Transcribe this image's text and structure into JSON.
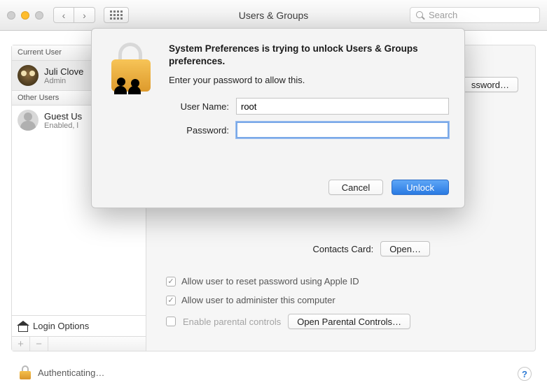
{
  "toolbar": {
    "title": "Users & Groups",
    "search_placeholder": "Search"
  },
  "sidebar": {
    "current_header": "Current User",
    "other_header": "Other Users",
    "current_user": {
      "name": "Juli Clove",
      "role": "Admin"
    },
    "guest_user": {
      "name": "Guest Us",
      "role": "Enabled, l"
    },
    "login_options": "Login Options"
  },
  "detail": {
    "change_password": "ssword…",
    "contacts_label": "Contacts Card:",
    "open_btn": "Open…",
    "checks": {
      "reset_apple_id": "Allow user to reset password using Apple ID",
      "administer": "Allow user to administer this computer",
      "parental_label": "Enable parental controls",
      "parental_btn": "Open Parental Controls…"
    }
  },
  "status": {
    "text": "Authenticating…"
  },
  "dialog": {
    "title": "System Preferences is trying to unlock Users & Groups preferences.",
    "subtitle": "Enter your password to allow this.",
    "username_label": "User Name:",
    "username_value": "root",
    "password_label": "Password:",
    "password_value": "",
    "cancel": "Cancel",
    "unlock": "Unlock"
  }
}
